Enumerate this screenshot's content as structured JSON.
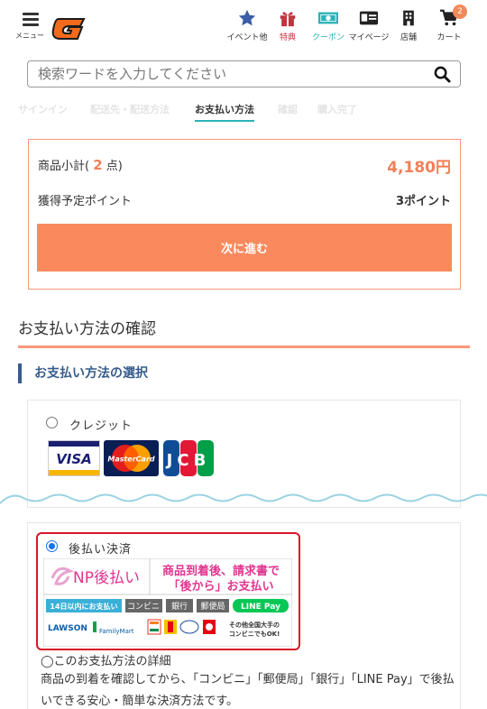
{
  "header": {
    "menu_label": "メニュー",
    "nav": [
      {
        "label": "イベント他",
        "icon": "star-icon"
      },
      {
        "label": "特典",
        "icon": "gift-icon"
      },
      {
        "label": "クーポン",
        "icon": "coupon-icon"
      },
      {
        "label": "マイページ",
        "icon": "id-card-icon"
      },
      {
        "label": "店舗",
        "icon": "building-icon"
      },
      {
        "label": "カート",
        "icon": "cart-icon",
        "badge": "2"
      }
    ]
  },
  "search": {
    "placeholder": "検索ワードを入力してください"
  },
  "steps": [
    "サインイン",
    "配送先・配送方法",
    "お支払い方法",
    "確認",
    "購入完了"
  ],
  "active_step": "お支払い方法",
  "summary": {
    "subtotal_prefix": "商品小計(",
    "quantity": "2",
    "subtotal_suffix": "点)",
    "price": "4,180円",
    "points_label": "獲得予定ポイント",
    "points_value": "3ポイント",
    "next_button": "次に進む"
  },
  "confirm_title": "お支払い方法の確認",
  "select_title": "お支払い方法の選択",
  "payment_options": {
    "credit": {
      "label": "クレジット",
      "selected": false,
      "cards": [
        "VISA",
        "MasterCard",
        "JCB"
      ]
    },
    "np": {
      "label": "後払い決済",
      "selected": true,
      "banner": {
        "brand": "NP後払い",
        "headline1": "商品到着後、請求書で",
        "headline2": "「後から」お支払い",
        "tags": [
          "14日以内にお支払い",
          "コンビニ",
          "銀行",
          "郵便局",
          "LINE Pay"
        ],
        "stores": [
          "LAWSON",
          "FamilyMart",
          "その他全国大手の",
          "コンビニでもOK!"
        ]
      }
    }
  },
  "detail": {
    "title": "◯このお支払方法の詳細",
    "text": "商品の到着を確認してから、「コンビニ」「郵便局」「銀行」「LINE Pay」で後払いできる安心・簡単な決済方法です。"
  },
  "colors": {
    "accent": "#fa8a5e",
    "teal": "#2ab2b8",
    "navy": "#375c8c",
    "np_red": "#d9152a"
  }
}
